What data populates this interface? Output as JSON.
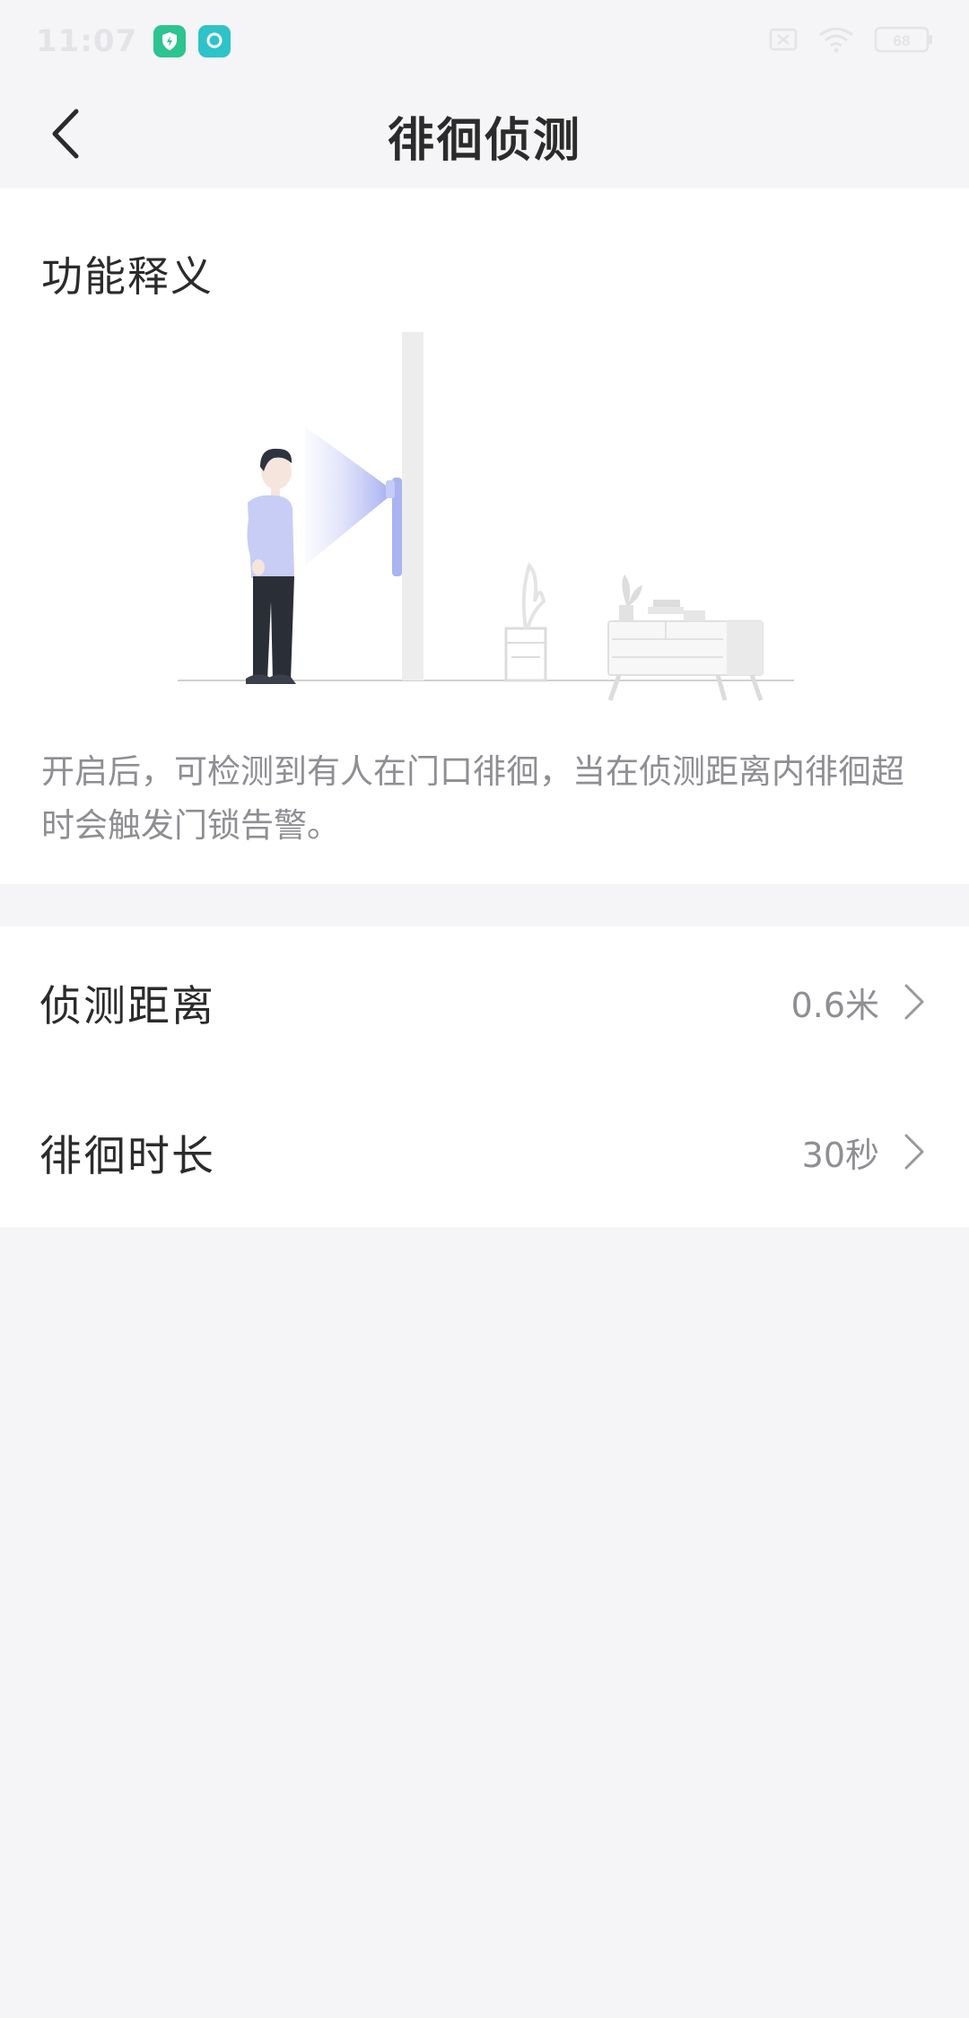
{
  "status_bar": {
    "time": "11:07",
    "app_icons": [
      "shield-lightning-icon",
      "mijia-app-icon"
    ],
    "right_icons": [
      "sim-off-icon",
      "wifi-icon",
      "battery-icon"
    ],
    "battery_level": "68"
  },
  "nav": {
    "back_icon": "chevron-left-icon",
    "title": "徘徊侦测"
  },
  "explain": {
    "section_title": "功能释义",
    "illustration_icon": "person-at-door-camera-illustration",
    "description": "开启后，可检测到有人在门口徘徊，当在侦测距离内徘徊超时会触发门锁告警。"
  },
  "settings": [
    {
      "label": "侦测距离",
      "value": "0.6米",
      "icon": "chevron-right-icon"
    },
    {
      "label": "徘徊时长",
      "value": "30秒",
      "icon": "chevron-right-icon"
    }
  ],
  "colors": {
    "background": "#f5f5f7",
    "card": "#ffffff",
    "text_primary": "#2b2b2b",
    "text_secondary": "#8e8e93",
    "accent_camera": "#aab4f0"
  }
}
